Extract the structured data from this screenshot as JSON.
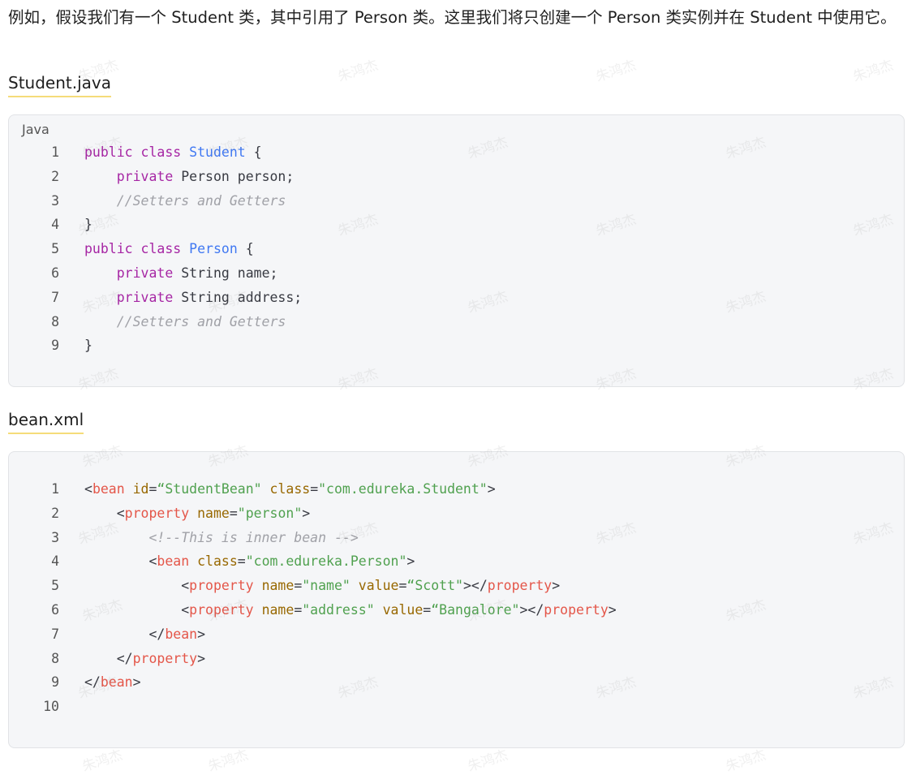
{
  "intro_text": "例如，假设我们有一个 Student 类，其中引用了 Person 类。这里我们将只创建一个 Person 类实例并在 Student 中使用它。",
  "watermark_text": "朱鸿杰",
  "sections": [
    {
      "filename": "Student.java",
      "language": "Java",
      "lines": [
        {
          "num": "1",
          "tokens": [
            {
              "t": "kw",
              "v": "public"
            },
            {
              "t": "pn",
              "v": " "
            },
            {
              "t": "kw",
              "v": "class"
            },
            {
              "t": "pn",
              "v": " "
            },
            {
              "t": "cls",
              "v": "Student"
            },
            {
              "t": "pn",
              "v": " {"
            }
          ]
        },
        {
          "num": "2",
          "tokens": [
            {
              "t": "pn",
              "v": "    "
            },
            {
              "t": "kw",
              "v": "private"
            },
            {
              "t": "pn",
              "v": " Person person;"
            }
          ]
        },
        {
          "num": "3",
          "tokens": [
            {
              "t": "pn",
              "v": "    "
            },
            {
              "t": "cm",
              "v": "//Setters and Getters"
            }
          ]
        },
        {
          "num": "4",
          "tokens": [
            {
              "t": "pn",
              "v": "}"
            }
          ]
        },
        {
          "num": "5",
          "tokens": [
            {
              "t": "kw",
              "v": "public"
            },
            {
              "t": "pn",
              "v": " "
            },
            {
              "t": "kw",
              "v": "class"
            },
            {
              "t": "pn",
              "v": " "
            },
            {
              "t": "cls",
              "v": "Person"
            },
            {
              "t": "pn",
              "v": " {"
            }
          ]
        },
        {
          "num": "6",
          "tokens": [
            {
              "t": "pn",
              "v": "    "
            },
            {
              "t": "kw",
              "v": "private"
            },
            {
              "t": "pn",
              "v": " String name;"
            }
          ]
        },
        {
          "num": "7",
          "tokens": [
            {
              "t": "pn",
              "v": "    "
            },
            {
              "t": "kw",
              "v": "private"
            },
            {
              "t": "pn",
              "v": " String address;"
            }
          ]
        },
        {
          "num": "8",
          "tokens": [
            {
              "t": "pn",
              "v": "    "
            },
            {
              "t": "cm",
              "v": "//Setters and Getters"
            }
          ]
        },
        {
          "num": "9",
          "tokens": [
            {
              "t": "pn",
              "v": "}"
            }
          ]
        }
      ]
    },
    {
      "filename": "bean.xml",
      "language": "",
      "lines": [
        {
          "num": "1",
          "tokens": [
            {
              "t": "pn",
              "v": "<"
            },
            {
              "t": "tag",
              "v": "bean"
            },
            {
              "t": "pn",
              "v": " "
            },
            {
              "t": "attr",
              "v": "id"
            },
            {
              "t": "pn",
              "v": "="
            },
            {
              "t": "str",
              "v": "“StudentBean\""
            },
            {
              "t": "pn",
              "v": " "
            },
            {
              "t": "attr",
              "v": "class"
            },
            {
              "t": "pn",
              "v": "="
            },
            {
              "t": "str",
              "v": "\"com.edureka.Student\""
            },
            {
              "t": "pn",
              "v": ">"
            }
          ]
        },
        {
          "num": "2",
          "tokens": [
            {
              "t": "pn",
              "v": "    <"
            },
            {
              "t": "tag",
              "v": "property"
            },
            {
              "t": "pn",
              "v": " "
            },
            {
              "t": "attr",
              "v": "name"
            },
            {
              "t": "pn",
              "v": "="
            },
            {
              "t": "str",
              "v": "\"person\""
            },
            {
              "t": "pn",
              "v": ">"
            }
          ]
        },
        {
          "num": "3",
          "tokens": [
            {
              "t": "pn",
              "v": "        "
            },
            {
              "t": "cm",
              "v": "<!--This is inner bean -->"
            }
          ]
        },
        {
          "num": "4",
          "tokens": [
            {
              "t": "pn",
              "v": "        <"
            },
            {
              "t": "tag",
              "v": "bean"
            },
            {
              "t": "pn",
              "v": " "
            },
            {
              "t": "attr",
              "v": "class"
            },
            {
              "t": "pn",
              "v": "="
            },
            {
              "t": "str",
              "v": "\"com.edureka.Person\""
            },
            {
              "t": "pn",
              "v": ">"
            }
          ]
        },
        {
          "num": "5",
          "tokens": [
            {
              "t": "pn",
              "v": "            <"
            },
            {
              "t": "tag",
              "v": "property"
            },
            {
              "t": "pn",
              "v": " "
            },
            {
              "t": "attr",
              "v": "name"
            },
            {
              "t": "pn",
              "v": "="
            },
            {
              "t": "str",
              "v": "\"name\""
            },
            {
              "t": "pn",
              "v": " "
            },
            {
              "t": "attr",
              "v": "value"
            },
            {
              "t": "pn",
              "v": "="
            },
            {
              "t": "str",
              "v": "“Scott\""
            },
            {
              "t": "pn",
              "v": "></"
            },
            {
              "t": "tag",
              "v": "property"
            },
            {
              "t": "pn",
              "v": ">"
            }
          ]
        },
        {
          "num": "6",
          "tokens": [
            {
              "t": "pn",
              "v": "            <"
            },
            {
              "t": "tag",
              "v": "property"
            },
            {
              "t": "pn",
              "v": " "
            },
            {
              "t": "attr",
              "v": "name"
            },
            {
              "t": "pn",
              "v": "="
            },
            {
              "t": "str",
              "v": "\"address\""
            },
            {
              "t": "pn",
              "v": " "
            },
            {
              "t": "attr",
              "v": "value"
            },
            {
              "t": "pn",
              "v": "="
            },
            {
              "t": "str",
              "v": "“Bangalore\""
            },
            {
              "t": "pn",
              "v": "></"
            },
            {
              "t": "tag",
              "v": "property"
            },
            {
              "t": "pn",
              "v": ">"
            }
          ]
        },
        {
          "num": "7",
          "tokens": [
            {
              "t": "pn",
              "v": "        </"
            },
            {
              "t": "tag",
              "v": "bean"
            },
            {
              "t": "pn",
              "v": ">"
            }
          ]
        },
        {
          "num": "8",
          "tokens": [
            {
              "t": "pn",
              "v": "    </"
            },
            {
              "t": "tag",
              "v": "property"
            },
            {
              "t": "pn",
              "v": ">"
            }
          ]
        },
        {
          "num": "9",
          "tokens": [
            {
              "t": "pn",
              "v": "</"
            },
            {
              "t": "tag",
              "v": "bean"
            },
            {
              "t": "pn",
              "v": ">"
            }
          ]
        },
        {
          "num": "10",
          "tokens": []
        }
      ]
    }
  ]
}
